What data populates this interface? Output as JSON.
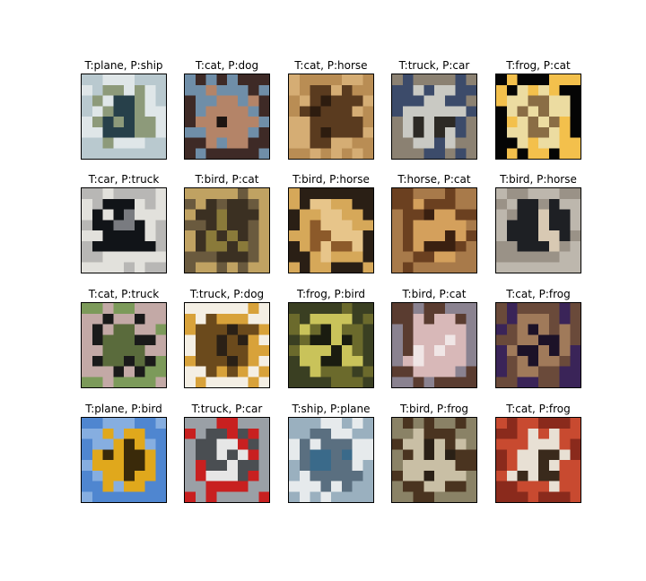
{
  "grid": {
    "cells": [
      {
        "title": "T:plane, P:ship",
        "subject": "seaplane on water",
        "palette": [
          "#b9c9cf",
          "#dfe6e8",
          "#8d9a7a",
          "#27404a"
        ]
      },
      {
        "title": "T:cat, P:dog",
        "subject": "person holding cat",
        "palette": [
          "#3e2a26",
          "#6f8ea8",
          "#b48468",
          "#1d1512"
        ]
      },
      {
        "title": "T:cat, P:horse",
        "subject": "brown cat",
        "palette": [
          "#b98d54",
          "#d5ad74",
          "#5a3b1f",
          "#2d1c0f"
        ]
      },
      {
        "title": "T:truck, P:car",
        "subject": "pickup truck",
        "palette": [
          "#8b8172",
          "#3c4b6a",
          "#c9c9c3",
          "#2d2a25"
        ]
      },
      {
        "title": "T:frog, P:cat",
        "subject": "yellow frog",
        "palette": [
          "#050505",
          "#f3c04c",
          "#ecdca1",
          "#8a6d45"
        ]
      },
      {
        "title": "T:car, P:truck",
        "subject": "black car",
        "palette": [
          "#b8b7b5",
          "#e2e1dc",
          "#111418",
          "#797b80"
        ]
      },
      {
        "title": "T:bird, P:cat",
        "subject": "ostrich",
        "palette": [
          "#c0a262",
          "#6a5a3e",
          "#3b3022",
          "#8a7a3a"
        ]
      },
      {
        "title": "T:bird, P:horse",
        "subject": "bird on fence",
        "palette": [
          "#2a1f15",
          "#d6a859",
          "#e7c58a",
          "#8c5a2a"
        ]
      },
      {
        "title": "T:horse, P:cat",
        "subject": "horse head",
        "palette": [
          "#a87a4a",
          "#6b4020",
          "#d4a05c",
          "#3a2010"
        ]
      },
      {
        "title": "T:bird, P:horse",
        "subject": "vulture",
        "palette": [
          "#bdb7ad",
          "#9a9287",
          "#1e2024",
          "#d8c9b3"
        ]
      },
      {
        "title": "T:cat, P:truck",
        "subject": "black cat on path",
        "palette": [
          "#7c9a5a",
          "#c3a9a6",
          "#1a1a1a",
          "#5a6b3c"
        ]
      },
      {
        "title": "T:truck, P:dog",
        "subject": "yellow dump truck",
        "palette": [
          "#f4efe4",
          "#d8a23a",
          "#6b4a1c",
          "#2a2016"
        ]
      },
      {
        "title": "T:frog, P:bird",
        "subject": "green frog",
        "palette": [
          "#3a3f22",
          "#6b6a2c",
          "#c9c35a",
          "#1a1c10"
        ]
      },
      {
        "title": "T:bird, P:cat",
        "subject": "bird head",
        "palette": [
          "#8a8290",
          "#5a3c30",
          "#d8b8b8",
          "#f0e6e6"
        ]
      },
      {
        "title": "T:cat, P:frog",
        "subject": "cat on purple",
        "palette": [
          "#3a2458",
          "#6a4a3a",
          "#a07a5a",
          "#1c1228"
        ]
      },
      {
        "title": "T:plane, P:bird",
        "subject": "yellow plane in sky",
        "palette": [
          "#4f86d0",
          "#86aee0",
          "#e0a81c",
          "#3a2a0a"
        ]
      },
      {
        "title": "T:truck, P:car",
        "subject": "fire truck",
        "palette": [
          "#9aa0a6",
          "#c82020",
          "#4a4e52",
          "#e6e6e6"
        ]
      },
      {
        "title": "T:ship, P:plane",
        "subject": "cruise ship",
        "palette": [
          "#9ab0bf",
          "#e6eaec",
          "#5a6f80",
          "#3a6a8a"
        ]
      },
      {
        "title": "T:bird, P:frog",
        "subject": "bird on ground",
        "palette": [
          "#8a8266",
          "#4a3420",
          "#c9bfa5",
          "#2a2016"
        ]
      },
      {
        "title": "T:cat, P:frog",
        "subject": "cat on red rug",
        "palette": [
          "#8a2a1c",
          "#c84a30",
          "#e8e0d4",
          "#3a2a1c"
        ]
      }
    ]
  }
}
